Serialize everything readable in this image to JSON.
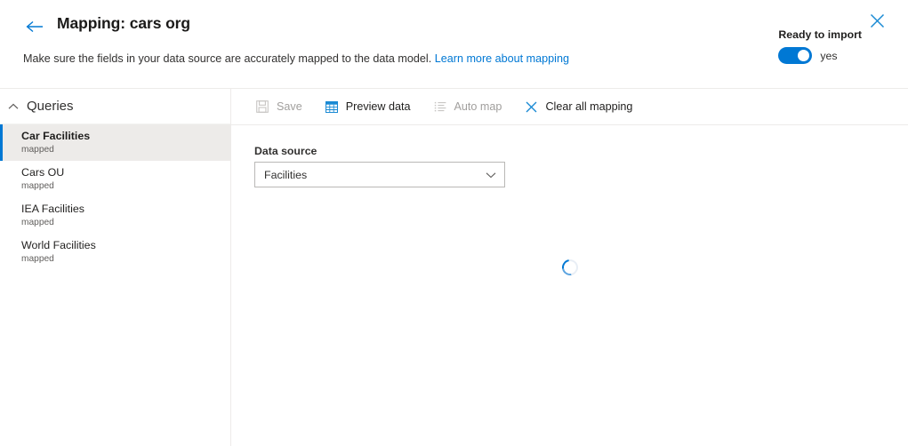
{
  "header": {
    "back_icon": "arrow-left-icon",
    "title": "Mapping: cars org",
    "subtitle_text": "Make sure the fields in your data source are accurately mapped to the data model.",
    "subtitle_link": "Learn more about mapping",
    "ready_label": "Ready to import",
    "toggle_state": "yes",
    "toggle_on": true,
    "close_icon": "close-icon"
  },
  "sidebar": {
    "section_title": "Queries",
    "collapse_icon": "chevron-up-icon",
    "items": [
      {
        "name": "Car Facilities",
        "status": "mapped",
        "selected": true
      },
      {
        "name": "Cars OU",
        "status": "mapped",
        "selected": false
      },
      {
        "name": "IEA Facilities",
        "status": "mapped",
        "selected": false
      },
      {
        "name": "World Facilities",
        "status": "mapped",
        "selected": false
      }
    ]
  },
  "toolbar": {
    "save_label": "Save",
    "save_icon": "save-icon",
    "save_disabled": true,
    "preview_label": "Preview data",
    "preview_icon": "table-grid-icon",
    "preview_disabled": false,
    "automap_label": "Auto map",
    "automap_icon": "list-icon",
    "automap_disabled": true,
    "clear_label": "Clear all mapping",
    "clear_icon": "close-icon",
    "clear_disabled": false
  },
  "main": {
    "data_source_label": "Data source",
    "data_source_value": "Facilities",
    "dropdown_icon": "chevron-down-icon",
    "loading": true
  },
  "colors": {
    "accent": "#0078d4",
    "text": "#201f1e",
    "muted": "#605e5c",
    "disabled": "#a19f9d",
    "divider": "#edebe9",
    "selected_bg": "#edebe9"
  }
}
